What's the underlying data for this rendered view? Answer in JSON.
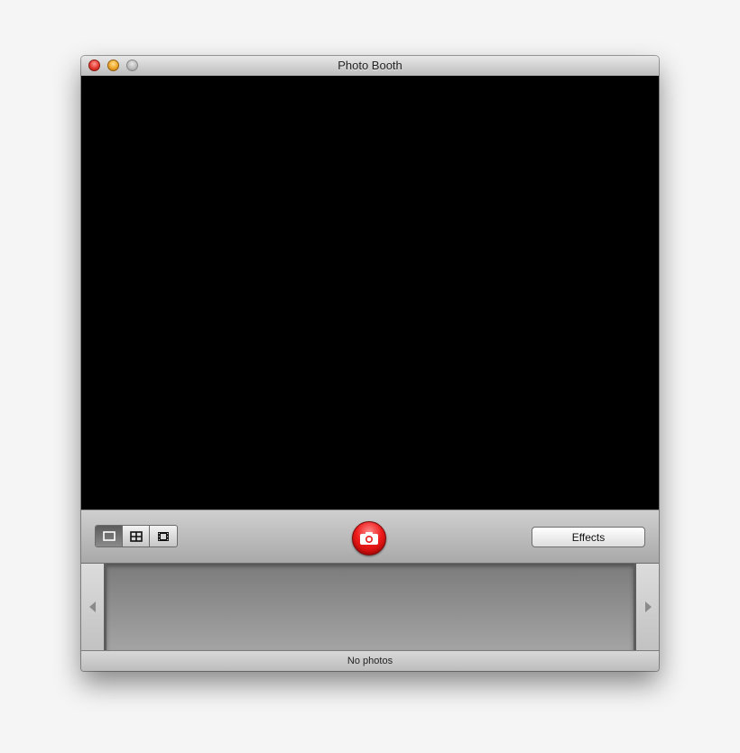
{
  "window": {
    "title": "Photo Booth",
    "controls": [
      "close-button",
      "minimize-button",
      "zoom-button"
    ]
  },
  "toolbar": {
    "layout_modes": [
      {
        "name": "single-photo",
        "icon": "single-frame-icon",
        "active": true
      },
      {
        "name": "four-up",
        "icon": "grid-icon",
        "active": false
      },
      {
        "name": "movie-clip",
        "icon": "film-strip-icon",
        "active": false
      }
    ],
    "shutter_icon": "camera-icon",
    "effects_label": "Effects"
  },
  "tray": {
    "left_arrow_icon": "triangle-left-icon",
    "right_arrow_icon": "triangle-right-icon"
  },
  "status": {
    "text": "No photos"
  },
  "colors": {
    "shutter_red": "#ee1b1b",
    "viewport": "#000000",
    "close": "#e2382f",
    "minimize": "#eea52b"
  }
}
